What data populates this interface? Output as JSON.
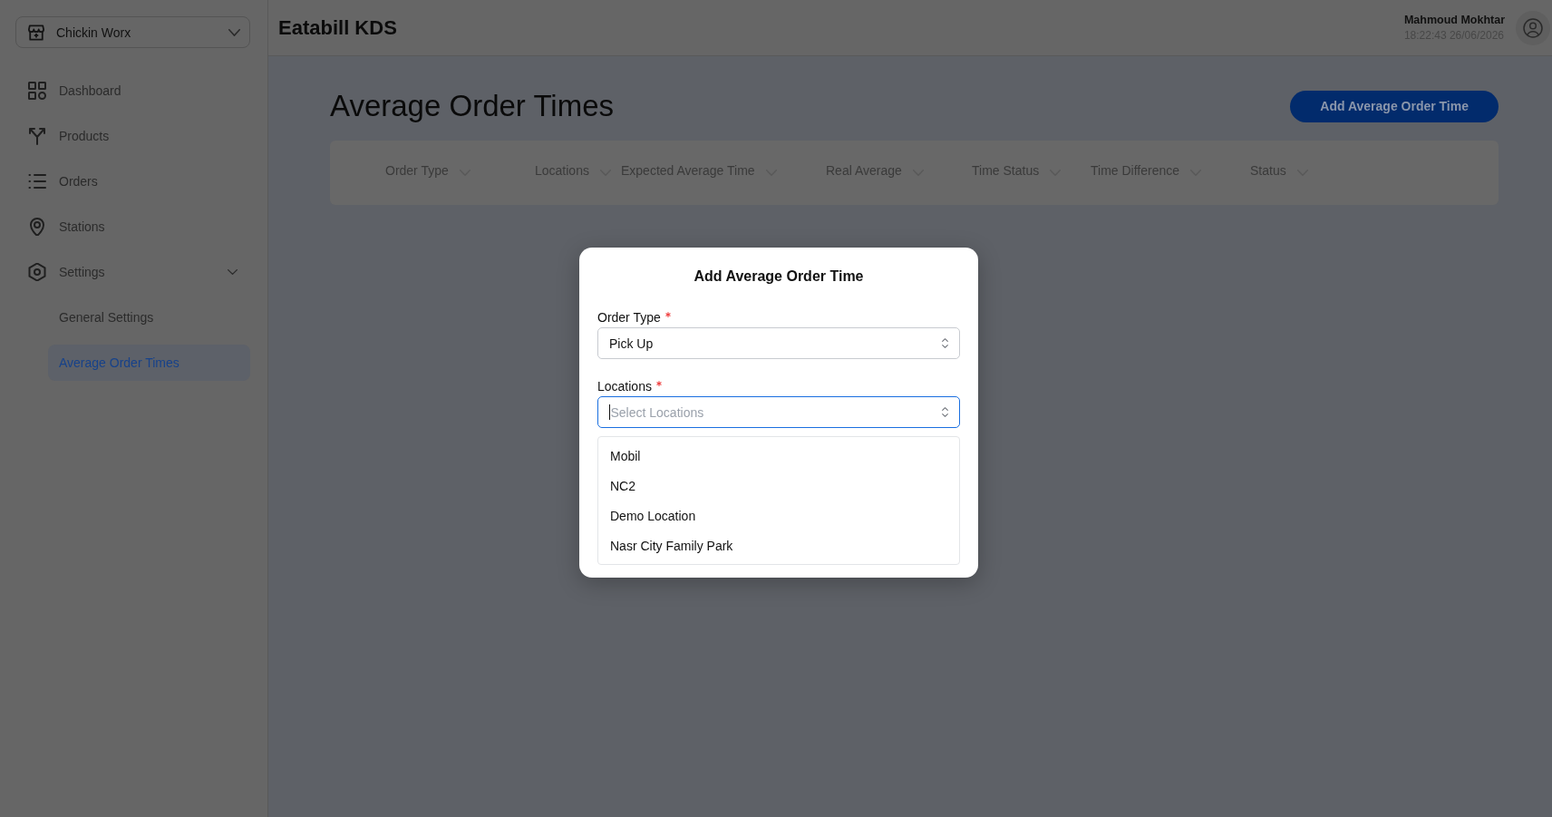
{
  "sidebar": {
    "store_selector": {
      "value": "Chickin Worx"
    },
    "items": [
      {
        "label": "Dashboard",
        "selected": false
      },
      {
        "label": "Products",
        "selected": false
      },
      {
        "label": "Orders",
        "selected": false
      },
      {
        "label": "Stations",
        "selected": false
      },
      {
        "label": "Settings",
        "selected": false,
        "expanded": true,
        "children": [
          {
            "label": "General Settings",
            "selected": false
          },
          {
            "label": "Average Order Times",
            "selected": true
          }
        ]
      }
    ]
  },
  "header": {
    "title": "Eatabill KDS",
    "user": {
      "name": "Mahmoud Mokhtar",
      "timestamp": "18:22:43 26/06/2026"
    }
  },
  "page": {
    "title": "Average Order Times",
    "add_button": "Add Average Order Time",
    "table": {
      "columns": [
        "Order Type",
        "Locations",
        "Expected Average Time",
        "Real Average",
        "Time Status",
        "Time Difference",
        "Status"
      ]
    }
  },
  "modal": {
    "title": "Add Average Order Time",
    "fields": [
      {
        "label": "Order Type",
        "required": true,
        "value": "Pick Up",
        "expanded": false
      },
      {
        "label": "Locations",
        "required": true,
        "placeholder": "Select Locations",
        "expanded": true,
        "options": [
          {
            "label": "Mobil",
            "selected": false
          },
          {
            "label": "NC2",
            "selected": false
          },
          {
            "label": "Demo Location",
            "selected": false
          },
          {
            "label": "Nasr City Family Park",
            "selected": false
          }
        ]
      }
    ]
  }
}
